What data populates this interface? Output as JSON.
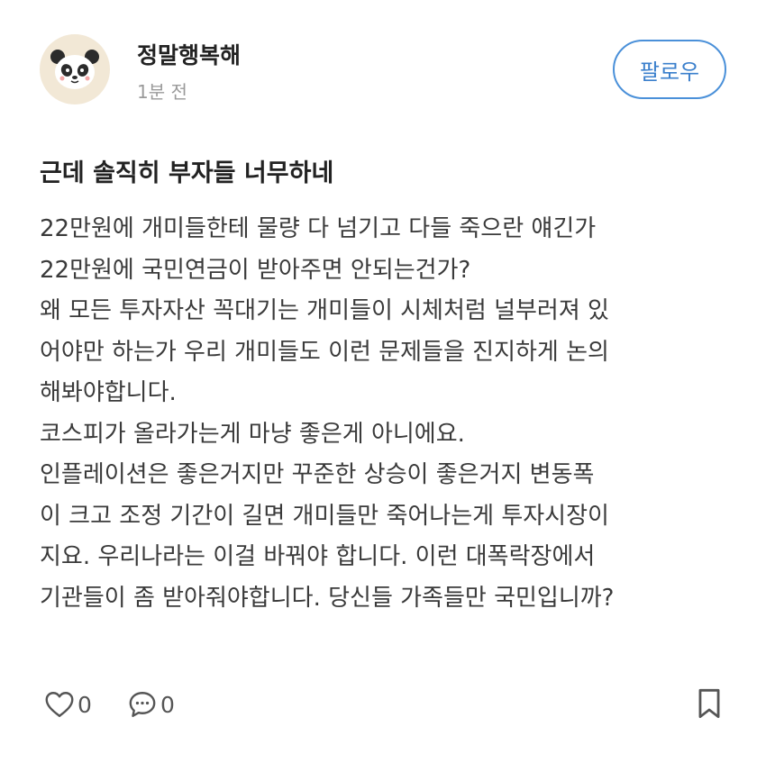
{
  "author": {
    "name": "정말행복해",
    "time": "1분 전",
    "avatar_icon": "panda-avatar-icon"
  },
  "follow_label": "팔로우",
  "post": {
    "title": "근데 솔직히 부자들 너무하네",
    "lines": [
      "22만원에 개미들한테 물량 다 넘기고 다들 죽으란 얘긴가",
      "22만원에 국민연금이 받아주면 안되는건가?",
      "왜 모든 투자자산 꼭대기는 개미들이 시체처럼 널부러져 있",
      "어야만 하는가 우리 개미들도 이런 문제들을 진지하게 논의",
      "해봐야합니다.",
      "코스피가 올라가는게 마냥 좋은게 아니에요.",
      "인플레이션은 좋은거지만 꾸준한 상승이 좋은거지 변동폭",
      "이 크고 조정 기간이 길면 개미들만 죽어나는게 투자시장이",
      "지요. 우리나라는 이걸 바꿔야 합니다. 이런 대폭락장에서",
      "기관들이 좀 받아줘야합니다. 당신들 가족들만 국민입니까?"
    ]
  },
  "footer": {
    "like_count": "0",
    "comment_count": "0",
    "like_icon": "heart-icon",
    "comment_icon": "speech-bubble-icon",
    "bookmark_icon": "bookmark-icon"
  },
  "colors": {
    "accent": "#4a90d9",
    "text": "#222222",
    "muted": "#9a9a9a"
  }
}
